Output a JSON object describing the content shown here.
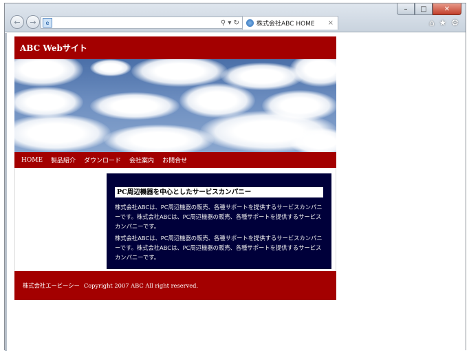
{
  "browser": {
    "address_value": "",
    "address_icons": "⚲ ▾ ↻",
    "tab_title": "株式会社ABC HOME",
    "tab_close": "×",
    "window_controls": [
      "–",
      "□",
      "✕"
    ],
    "nav_back": "←",
    "nav_forward": "→",
    "toolbar_icons": [
      "⌂",
      "★",
      "⚙"
    ],
    "favicon": "e"
  },
  "site": {
    "title": "ABC Webサイト",
    "menu": [
      "HOME",
      "製品紹介",
      "ダウンロード",
      "会社案内",
      "お問合せ"
    ],
    "article": {
      "heading": "PC周辺機器を中心としたサービスカンパニー",
      "paragraphs": [
        "株式会社ABCは、PC周辺機器の販売、各種サポートを提供するサービスカンパニーです。株式会社ABCは、PC周辺機器の販売、各種サポートを提供するサービスカンパニーです。",
        "株式会社ABCは、PC周辺機器の販売、各種サポートを提供するサービスカンパニーです。株式会社ABCは、PC周辺機器の販売、各種サポートを提供するサービスカンパニーです。"
      ]
    },
    "footer": {
      "company": "株式会社エービーシー",
      "copyright": "Copyright 2007 ABC All right reserved."
    }
  },
  "colors": {
    "brand_red": "#a30000",
    "article_bg": "#00003a"
  }
}
